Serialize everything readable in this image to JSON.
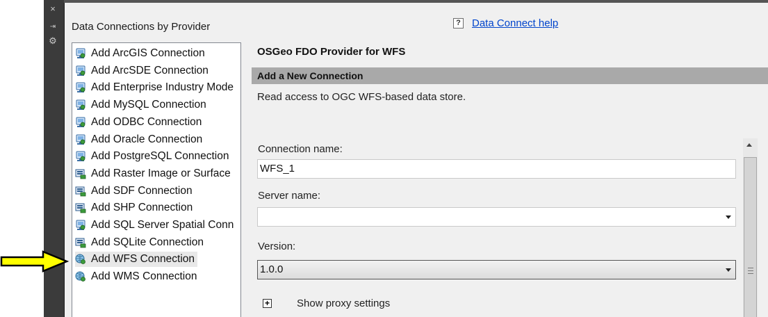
{
  "left_panel": {
    "title": "Data Connections by Provider",
    "items": [
      {
        "label": "Add ArcGIS Connection",
        "icon": "db-connection-icon"
      },
      {
        "label": "Add ArcSDE Connection",
        "icon": "db-connection-icon"
      },
      {
        "label": "Add Enterprise Industry Mode",
        "icon": "db-connection-icon"
      },
      {
        "label": "Add MySQL Connection",
        "icon": "db-connection-icon"
      },
      {
        "label": "Add ODBC Connection",
        "icon": "db-connection-icon"
      },
      {
        "label": "Add Oracle Connection",
        "icon": "db-connection-icon"
      },
      {
        "label": "Add PostgreSQL Connection",
        "icon": "db-connection-icon"
      },
      {
        "label": "Add Raster Image or Surface",
        "icon": "file-connection-icon"
      },
      {
        "label": "Add SDF Connection",
        "icon": "file-connection-icon"
      },
      {
        "label": "Add SHP Connection",
        "icon": "file-connection-icon"
      },
      {
        "label": "Add SQL Server Spatial Conn",
        "icon": "db-connection-icon"
      },
      {
        "label": "Add SQLite Connection",
        "icon": "file-connection-icon"
      },
      {
        "label": "Add WFS Connection",
        "icon": "web-connection-icon",
        "selected": true
      },
      {
        "label": "Add WMS Connection",
        "icon": "web-connection-icon"
      }
    ]
  },
  "help": {
    "icon_label": "?",
    "link": "Data Connect help"
  },
  "provider": {
    "title": "OSGeo FDO Provider for WFS",
    "section": "Add a New Connection",
    "description": "Read access to OGC WFS-based data store."
  },
  "form": {
    "connection_name_label": "Connection name:",
    "connection_name_value": "WFS_1",
    "server_name_label": "Server name:",
    "server_name_value": "",
    "version_label": "Version:",
    "version_value": "1.0.0",
    "proxy_toggle_icon": "+",
    "proxy_label": "Show proxy settings"
  },
  "palette_strip": {
    "buttons": [
      "×",
      "⇥",
      "⚙"
    ]
  },
  "colors": {
    "link": "#0044cc",
    "arrow_fill": "#ffff00",
    "section_bar": "#a9a9a9",
    "strip": "#3b3b3b"
  }
}
